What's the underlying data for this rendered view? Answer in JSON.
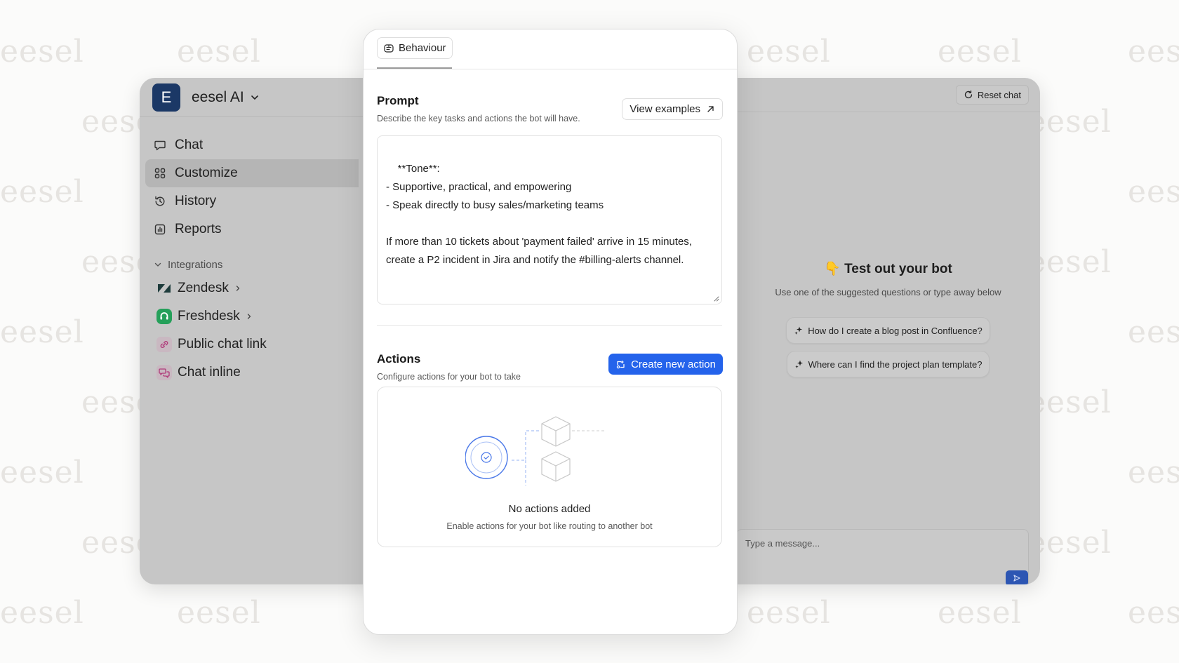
{
  "watermark": {
    "text": "eesel"
  },
  "sidebar": {
    "workspace_initial": "E",
    "workspace_name": "eesel AI",
    "nav": [
      {
        "label": "Chat",
        "icon": "chat-bubble-icon"
      },
      {
        "label": "Customize",
        "icon": "customize-grid-icon",
        "active": true
      },
      {
        "label": "History",
        "icon": "history-icon"
      },
      {
        "label": "Reports",
        "icon": "reports-icon"
      }
    ],
    "integrations_label": "Integrations",
    "integrations": [
      {
        "label": "Zendesk",
        "icon": "zendesk-icon",
        "expandable": true
      },
      {
        "label": "Freshdesk",
        "icon": "freshdesk-icon",
        "expandable": true
      },
      {
        "label": "Public chat link",
        "icon": "link-icon"
      },
      {
        "label": "Chat inline",
        "icon": "chat-inline-icon"
      }
    ]
  },
  "panel": {
    "tab_label": "Behaviour",
    "prompt": {
      "title": "Prompt",
      "subtitle": "Describe the key tasks and actions the bot will have.",
      "view_examples_label": "View examples",
      "text": "**Tone**:\n- Supportive, practical, and empowering\n- Speak directly to busy sales/marketing teams\n\nIf more than 10 tickets about 'payment failed' arrive in 15 minutes,\ncreate a P2 incident in Jira and notify the #billing-alerts channel."
    },
    "actions": {
      "title": "Actions",
      "subtitle": "Configure actions for your bot to take",
      "create_label": "Create new action",
      "empty_title": "No actions added",
      "empty_subtitle": "Enable actions for your bot like routing to another bot"
    }
  },
  "chat": {
    "reset_label": "Reset chat",
    "test_emoji": "👇",
    "test_title": "Test out your bot",
    "test_subtitle": "Use one of the suggested questions or type away below",
    "suggestions": [
      "How do I create a blog post in Confluence?",
      "Where can I find the project plan template?"
    ],
    "input_placeholder": "Type a message..."
  },
  "colors": {
    "brand_dark": "#1b3866",
    "primary_button": "#2463eb",
    "send_button": "#2d56b3",
    "freshdesk_green": "#25a05a"
  }
}
